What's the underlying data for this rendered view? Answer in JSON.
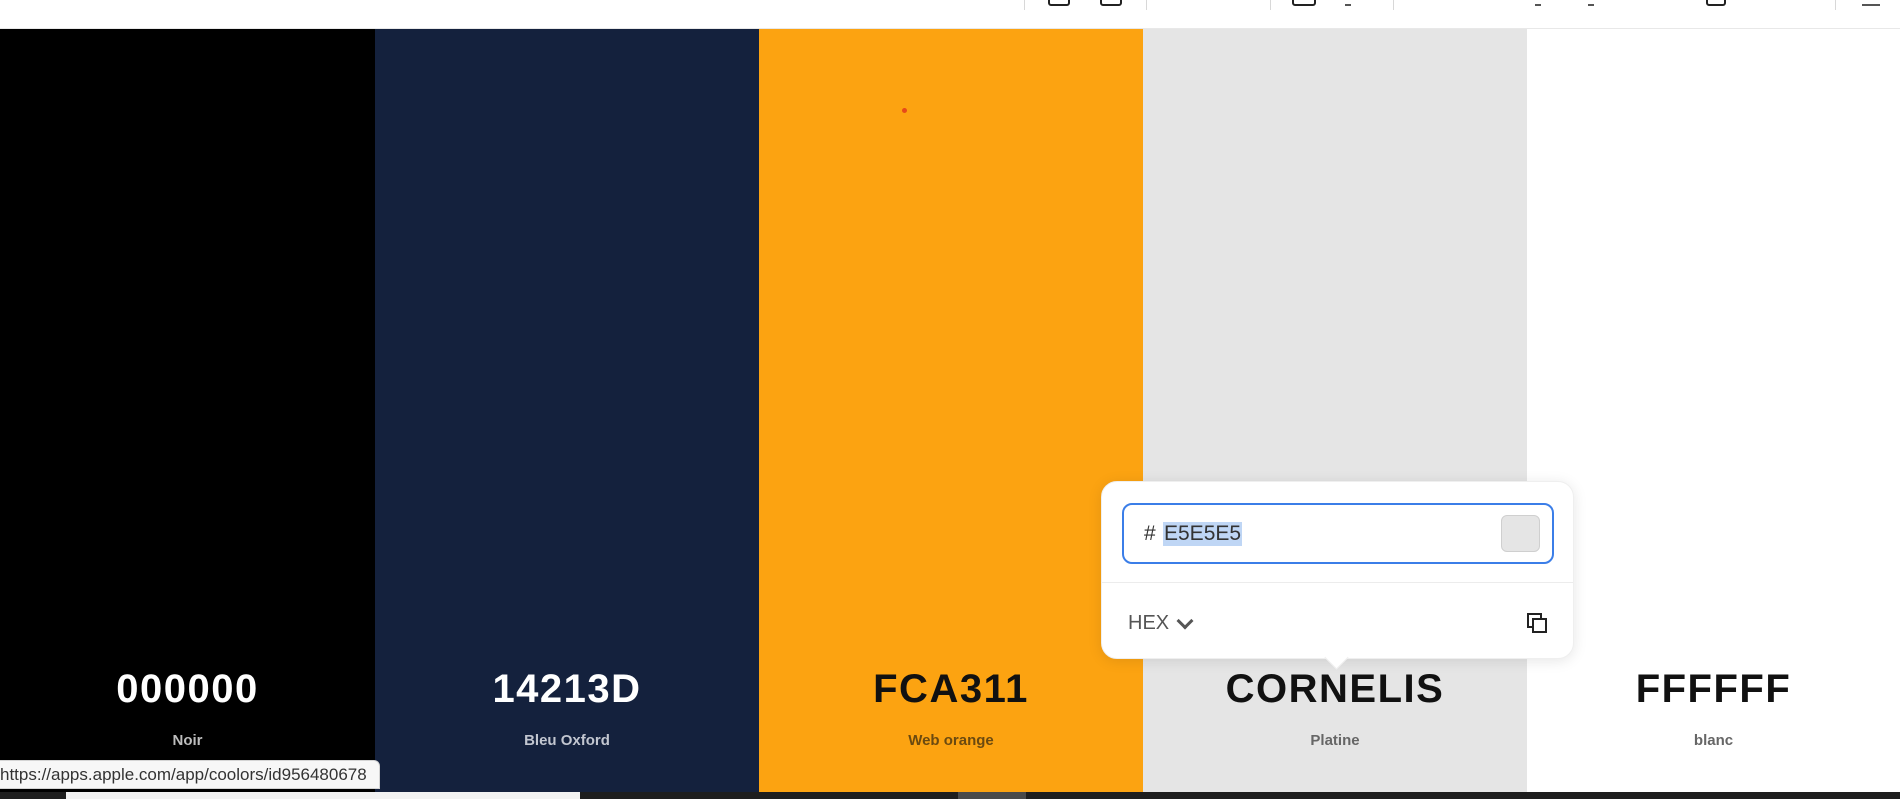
{
  "palette": {
    "colors": [
      {
        "hex": "000000",
        "name": "Noir",
        "bg": "#000000",
        "hex_color": "#ffffff",
        "name_color": "#bdbdbd"
      },
      {
        "hex": "14213D",
        "name": "Bleu Oxford",
        "bg": "#14213D",
        "hex_color": "#ffffff",
        "name_color": "#c2c6d0"
      },
      {
        "hex": "FCA311",
        "name": "Web orange",
        "bg": "#FCA311",
        "hex_color": "#111111",
        "name_color": "#6b4a10"
      },
      {
        "hex": "CORNELIS",
        "name": "Platine",
        "bg": "#E5E5E5",
        "hex_color": "#111111",
        "name_color": "#666666"
      },
      {
        "hex": "FFFFFF",
        "name": "blanc",
        "bg": "#FFFFFF",
        "hex_color": "#111111",
        "name_color": "#666666"
      }
    ]
  },
  "color_popover": {
    "prefix": "#",
    "value": "E5E5E5",
    "preview_color": "#E5E5E5",
    "format_label": "HEX",
    "accent": "#3b7ee8",
    "copy_icon": "copy-icon",
    "dropdown_icon": "chevron-down-icon"
  },
  "status_bar": {
    "url": "https://apps.apple.com/app/coolors/id956480678"
  }
}
